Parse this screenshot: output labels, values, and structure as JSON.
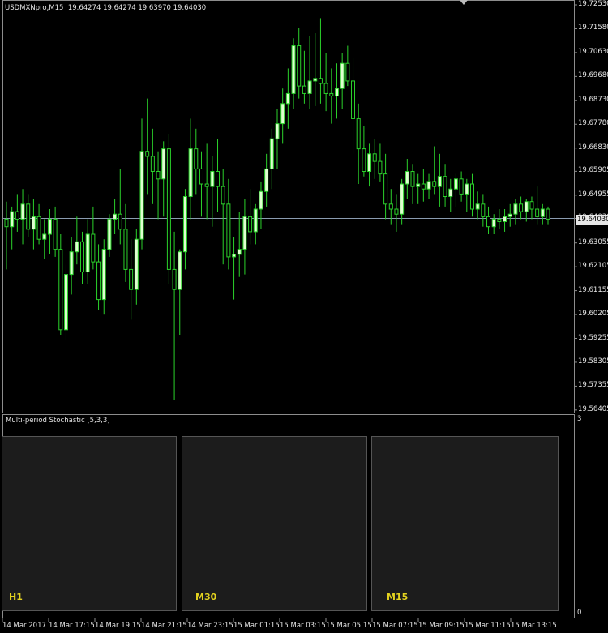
{
  "header": {
    "symbol": "USDMXNpro,M15",
    "ohlc": "19.64274 19.64274 19.63970 19.64030"
  },
  "price_axis": {
    "ticks": [
      "19.72530",
      "19.71580",
      "19.70630",
      "19.69680",
      "19.68730",
      "19.67780",
      "19.66830",
      "19.65905",
      "19.64955",
      "19.64030",
      "19.63055",
      "19.62105",
      "19.61155",
      "19.60205",
      "19.59255",
      "19.58305",
      "19.57355",
      "19.56405"
    ],
    "current_price": "19.64030"
  },
  "indicator": {
    "title": "Multi-period Stochastic [5,3,3]",
    "scale_top": "3",
    "scale_bottom": "0",
    "panels": [
      {
        "timeframe": "H1"
      },
      {
        "timeframe": "M30"
      },
      {
        "timeframe": "M15"
      }
    ]
  },
  "time_axis": {
    "labels": [
      "14 Mar 2017",
      "14 Mar 17:15",
      "14 Mar 19:15",
      "14 Mar 21:15",
      "14 Mar 23:15",
      "15 Mar 01:15",
      "15 Mar 03:15",
      "15 Mar 05:15",
      "15 Mar 07:15",
      "15 Mar 09:15",
      "15 Mar 11:15",
      "15 Mar 13:15"
    ]
  },
  "colors": {
    "background": "#000000",
    "bull_body": "#dfffd0",
    "wick": "#2bd22b",
    "bear_body": "#000000",
    "price_line": "#8a9bb0",
    "stoch_main": "#2ea82e",
    "stoch_signal": "#e0203a",
    "level_line": "#9a9a9a",
    "timeframe_label": "#e3d21f"
  },
  "icons": {
    "bug": "bug-icon"
  },
  "chart_data": {
    "type": "candlestick",
    "symbol": "USDMXNpro",
    "timeframe": "M15",
    "ylim": [
      19.564,
      19.7253
    ],
    "candles": [
      {
        "o": 19.64,
        "h": 19.647,
        "l": 19.62,
        "c": 19.637
      },
      {
        "o": 19.637,
        "h": 19.645,
        "l": 19.628,
        "c": 19.643
      },
      {
        "o": 19.643,
        "h": 19.65,
        "l": 19.635,
        "c": 19.64
      },
      {
        "o": 19.64,
        "h": 19.652,
        "l": 19.63,
        "c": 19.646
      },
      {
        "o": 19.646,
        "h": 19.65,
        "l": 19.633,
        "c": 19.636
      },
      {
        "o": 19.636,
        "h": 19.648,
        "l": 19.628,
        "c": 19.641
      },
      {
        "o": 19.641,
        "h": 19.646,
        "l": 19.63,
        "c": 19.632
      },
      {
        "o": 19.632,
        "h": 19.64,
        "l": 19.624,
        "c": 19.634
      },
      {
        "o": 19.634,
        "h": 19.644,
        "l": 19.626,
        "c": 19.64
      },
      {
        "o": 19.64,
        "h": 19.645,
        "l": 19.625,
        "c": 19.628
      },
      {
        "o": 19.628,
        "h": 19.634,
        "l": 19.594,
        "c": 19.596
      },
      {
        "o": 19.596,
        "h": 19.622,
        "l": 19.592,
        "c": 19.618
      },
      {
        "o": 19.618,
        "h": 19.633,
        "l": 19.61,
        "c": 19.627
      },
      {
        "o": 19.627,
        "h": 19.641,
        "l": 19.622,
        "c": 19.631
      },
      {
        "o": 19.631,
        "h": 19.635,
        "l": 19.614,
        "c": 19.619
      },
      {
        "o": 19.619,
        "h": 19.64,
        "l": 19.614,
        "c": 19.634
      },
      {
        "o": 19.634,
        "h": 19.645,
        "l": 19.62,
        "c": 19.623
      },
      {
        "o": 19.623,
        "h": 19.63,
        "l": 19.604,
        "c": 19.608
      },
      {
        "o": 19.608,
        "h": 19.632,
        "l": 19.602,
        "c": 19.628
      },
      {
        "o": 19.628,
        "h": 19.642,
        "l": 19.625,
        "c": 19.64
      },
      {
        "o": 19.64,
        "h": 19.648,
        "l": 19.634,
        "c": 19.642
      },
      {
        "o": 19.642,
        "h": 19.66,
        "l": 19.63,
        "c": 19.636
      },
      {
        "o": 19.636,
        "h": 19.646,
        "l": 19.615,
        "c": 19.62
      },
      {
        "o": 19.62,
        "h": 19.632,
        "l": 19.6,
        "c": 19.612
      },
      {
        "o": 19.612,
        "h": 19.636,
        "l": 19.606,
        "c": 19.632
      },
      {
        "o": 19.632,
        "h": 19.68,
        "l": 19.628,
        "c": 19.667
      },
      {
        "o": 19.667,
        "h": 19.688,
        "l": 19.65,
        "c": 19.665
      },
      {
        "o": 19.665,
        "h": 19.676,
        "l": 19.646,
        "c": 19.659
      },
      {
        "o": 19.659,
        "h": 19.667,
        "l": 19.64,
        "c": 19.656
      },
      {
        "o": 19.656,
        "h": 19.671,
        "l": 19.641,
        "c": 19.668
      },
      {
        "o": 19.668,
        "h": 19.674,
        "l": 19.614,
        "c": 19.62
      },
      {
        "o": 19.62,
        "h": 19.635,
        "l": 19.568,
        "c": 19.612
      },
      {
        "o": 19.612,
        "h": 19.628,
        "l": 19.594,
        "c": 19.627
      },
      {
        "o": 19.627,
        "h": 19.652,
        "l": 19.62,
        "c": 19.649
      },
      {
        "o": 19.649,
        "h": 19.68,
        "l": 19.64,
        "c": 19.668
      },
      {
        "o": 19.668,
        "h": 19.676,
        "l": 19.65,
        "c": 19.66
      },
      {
        "o": 19.66,
        "h": 19.667,
        "l": 19.641,
        "c": 19.654
      },
      {
        "o": 19.654,
        "h": 19.67,
        "l": 19.64,
        "c": 19.653
      },
      {
        "o": 19.653,
        "h": 19.665,
        "l": 19.637,
        "c": 19.659
      },
      {
        "o": 19.659,
        "h": 19.672,
        "l": 19.643,
        "c": 19.653
      },
      {
        "o": 19.653,
        "h": 19.66,
        "l": 19.622,
        "c": 19.646
      },
      {
        "o": 19.646,
        "h": 19.656,
        "l": 19.62,
        "c": 19.625
      },
      {
        "o": 19.625,
        "h": 19.633,
        "l": 19.608,
        "c": 19.626
      },
      {
        "o": 19.626,
        "h": 19.643,
        "l": 19.617,
        "c": 19.628
      },
      {
        "o": 19.628,
        "h": 19.648,
        "l": 19.618,
        "c": 19.641
      },
      {
        "o": 19.641,
        "h": 19.652,
        "l": 19.63,
        "c": 19.635
      },
      {
        "o": 19.635,
        "h": 19.646,
        "l": 19.63,
        "c": 19.644
      },
      {
        "o": 19.644,
        "h": 19.655,
        "l": 19.636,
        "c": 19.651
      },
      {
        "o": 19.651,
        "h": 19.666,
        "l": 19.645,
        "c": 19.66
      },
      {
        "o": 19.66,
        "h": 19.676,
        "l": 19.652,
        "c": 19.672
      },
      {
        "o": 19.672,
        "h": 19.684,
        "l": 19.66,
        "c": 19.678
      },
      {
        "o": 19.678,
        "h": 19.692,
        "l": 19.67,
        "c": 19.686
      },
      {
        "o": 19.686,
        "h": 19.7,
        "l": 19.676,
        "c": 19.69
      },
      {
        "o": 19.69,
        "h": 19.712,
        "l": 19.684,
        "c": 19.709
      },
      {
        "o": 19.709,
        "h": 19.716,
        "l": 19.688,
        "c": 19.693
      },
      {
        "o": 19.693,
        "h": 19.707,
        "l": 19.686,
        "c": 19.69
      },
      {
        "o": 19.69,
        "h": 19.713,
        "l": 19.684,
        "c": 19.695
      },
      {
        "o": 19.695,
        "h": 19.714,
        "l": 19.685,
        "c": 19.696
      },
      {
        "o": 19.696,
        "h": 19.72,
        "l": 19.686,
        "c": 19.694
      },
      {
        "o": 19.694,
        "h": 19.706,
        "l": 19.683,
        "c": 19.69
      },
      {
        "o": 19.69,
        "h": 19.7,
        "l": 19.678,
        "c": 19.689
      },
      {
        "o": 19.689,
        "h": 19.702,
        "l": 19.68,
        "c": 19.692
      },
      {
        "o": 19.692,
        "h": 19.706,
        "l": 19.684,
        "c": 19.702
      },
      {
        "o": 19.702,
        "h": 19.709,
        "l": 19.693,
        "c": 19.695
      },
      {
        "o": 19.695,
        "h": 19.704,
        "l": 19.666,
        "c": 19.68
      },
      {
        "o": 19.68,
        "h": 19.686,
        "l": 19.654,
        "c": 19.668
      },
      {
        "o": 19.668,
        "h": 19.677,
        "l": 19.657,
        "c": 19.659
      },
      {
        "o": 19.659,
        "h": 19.67,
        "l": 19.653,
        "c": 19.666
      },
      {
        "o": 19.666,
        "h": 19.672,
        "l": 19.656,
        "c": 19.663
      },
      {
        "o": 19.663,
        "h": 19.67,
        "l": 19.655,
        "c": 19.658
      },
      {
        "o": 19.658,
        "h": 19.666,
        "l": 19.64,
        "c": 19.646
      },
      {
        "o": 19.646,
        "h": 19.652,
        "l": 19.638,
        "c": 19.644
      },
      {
        "o": 19.644,
        "h": 19.65,
        "l": 19.635,
        "c": 19.642
      },
      {
        "o": 19.642,
        "h": 19.656,
        "l": 19.638,
        "c": 19.654
      },
      {
        "o": 19.654,
        "h": 19.664,
        "l": 19.648,
        "c": 19.659
      },
      {
        "o": 19.659,
        "h": 19.662,
        "l": 19.646,
        "c": 19.653
      },
      {
        "o": 19.653,
        "h": 19.658,
        "l": 19.646,
        "c": 19.654
      },
      {
        "o": 19.654,
        "h": 19.66,
        "l": 19.647,
        "c": 19.652
      },
      {
        "o": 19.652,
        "h": 19.658,
        "l": 19.648,
        "c": 19.655
      },
      {
        "o": 19.655,
        "h": 19.669,
        "l": 19.65,
        "c": 19.653
      },
      {
        "o": 19.653,
        "h": 19.666,
        "l": 19.645,
        "c": 19.657
      },
      {
        "o": 19.657,
        "h": 19.662,
        "l": 19.645,
        "c": 19.649
      },
      {
        "o": 19.649,
        "h": 19.656,
        "l": 19.643,
        "c": 19.652
      },
      {
        "o": 19.652,
        "h": 19.658,
        "l": 19.645,
        "c": 19.656
      },
      {
        "o": 19.656,
        "h": 19.659,
        "l": 19.647,
        "c": 19.65
      },
      {
        "o": 19.65,
        "h": 19.656,
        "l": 19.643,
        "c": 19.654
      },
      {
        "o": 19.654,
        "h": 19.658,
        "l": 19.641,
        "c": 19.644
      },
      {
        "o": 19.644,
        "h": 19.651,
        "l": 19.64,
        "c": 19.646
      },
      {
        "o": 19.646,
        "h": 19.65,
        "l": 19.637,
        "c": 19.641
      },
      {
        "o": 19.641,
        "h": 19.645,
        "l": 19.634,
        "c": 19.637
      },
      {
        "o": 19.637,
        "h": 19.642,
        "l": 19.634,
        "c": 19.64
      },
      {
        "o": 19.64,
        "h": 19.644,
        "l": 19.636,
        "c": 19.639
      },
      {
        "o": 19.639,
        "h": 19.644,
        "l": 19.635,
        "c": 19.641
      },
      {
        "o": 19.641,
        "h": 19.646,
        "l": 19.637,
        "c": 19.642
      },
      {
        "o": 19.642,
        "h": 19.648,
        "l": 19.638,
        "c": 19.646
      },
      {
        "o": 19.646,
        "h": 19.649,
        "l": 19.64,
        "c": 19.643
      },
      {
        "o": 19.643,
        "h": 19.648,
        "l": 19.639,
        "c": 19.647
      },
      {
        "o": 19.647,
        "h": 19.649,
        "l": 19.64,
        "c": 19.644
      },
      {
        "o": 19.644,
        "h": 19.653,
        "l": 19.638,
        "c": 19.641
      },
      {
        "o": 19.641,
        "h": 19.646,
        "l": 19.638,
        "c": 19.644
      },
      {
        "o": 19.644,
        "h": 19.645,
        "l": 19.638,
        "c": 19.64
      }
    ],
    "current_price": 19.6403
  }
}
